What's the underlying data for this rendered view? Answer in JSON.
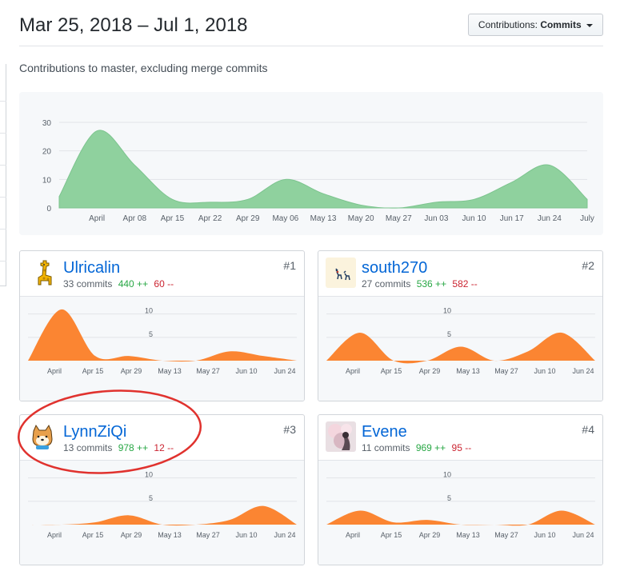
{
  "header": {
    "date_range": "Mar 25, 2018 – Jul 1, 2018",
    "contrib_label": "Contributions:",
    "contrib_value": "Commits"
  },
  "subtitle": "Contributions to master, excluding merge commits",
  "colors": {
    "main_area": "#8fd19e",
    "main_area_stroke": "#7cc48e",
    "user_area": "#fb8532",
    "link": "#0366d6",
    "additions": "#28a745",
    "deletions": "#cb2431",
    "highlight": "#e0322e"
  },
  "main_chart": {
    "y_ticks": [
      "30",
      "20",
      "10",
      "0"
    ],
    "x_ticks": [
      "April",
      "Apr 08",
      "Apr 15",
      "Apr 22",
      "Apr 29",
      "May 06",
      "May 13",
      "May 20",
      "May 27",
      "Jun 03",
      "Jun 10",
      "Jun 17",
      "Jun 24",
      "July"
    ]
  },
  "chart_data": [
    {
      "type": "area",
      "title": "",
      "x": [
        "Mar 25",
        "April",
        "Apr 08",
        "Apr 15",
        "Apr 22",
        "Apr 29",
        "May 06",
        "May 13",
        "May 20",
        "May 27",
        "Jun 03",
        "Jun 10",
        "Jun 17",
        "Jun 24",
        "July"
      ],
      "values": [
        4,
        27,
        15,
        3,
        2,
        3,
        10,
        5,
        1,
        0,
        2,
        3,
        9,
        15,
        3
      ],
      "ylim": [
        0,
        30
      ],
      "y_ticks": [
        0,
        10,
        20,
        30
      ],
      "grid": true
    },
    {
      "type": "area",
      "series_label": "Ulricalin",
      "x": [
        "Apr 1",
        "Apr 15",
        "Apr 29",
        "May 13",
        "May 27",
        "Jun 10",
        "Jun 24"
      ],
      "values": [
        11,
        1,
        1,
        0,
        0,
        2,
        1
      ],
      "ylim": [
        0,
        12
      ],
      "y_ticks": [
        5,
        10
      ]
    },
    {
      "type": "area",
      "series_label": "south270",
      "x": [
        "Apr 1",
        "Apr 15",
        "Apr 29",
        "May 13",
        "May 27",
        "Jun 10",
        "Jun 24"
      ],
      "values": [
        6,
        0,
        0,
        3,
        0,
        2,
        6
      ],
      "ylim": [
        0,
        12
      ],
      "y_ticks": [
        5,
        10
      ]
    },
    {
      "type": "area",
      "series_label": "LynnZiQi",
      "x": [
        "Apr 1",
        "Apr 15",
        "Apr 29",
        "May 13",
        "May 27",
        "Jun 10",
        "Jun 24"
      ],
      "values": [
        0,
        0.5,
        2,
        0,
        0,
        1,
        4
      ],
      "ylim": [
        0,
        12
      ],
      "y_ticks": [
        5,
        10
      ]
    },
    {
      "type": "area",
      "series_label": "Evene",
      "x": [
        "Apr 1",
        "Apr 15",
        "Apr 29",
        "May 13",
        "May 27",
        "Jun 10",
        "Jun 24"
      ],
      "values": [
        3,
        0.5,
        1,
        0,
        0,
        0,
        3
      ],
      "ylim": [
        0,
        12
      ],
      "y_ticks": [
        5,
        10
      ]
    }
  ],
  "user_chart": {
    "y_ticks": [
      "10",
      "5"
    ],
    "x_ticks": [
      "April",
      "Apr 15",
      "Apr 29",
      "May 13",
      "May 27",
      "Jun 10",
      "Jun 24"
    ]
  },
  "contributors": [
    {
      "name": "Ulricalin",
      "commits": "33 commits",
      "additions": "440 ++",
      "deletions": "60 --",
      "rank": "#1",
      "avatar": "giraffe-avatar"
    },
    {
      "name": "south270",
      "commits": "27 commits",
      "additions": "536 ++",
      "deletions": "582 --",
      "rank": "#2",
      "avatar": "deer-avatar"
    },
    {
      "name": "LynnZiQi",
      "commits": "13 commits",
      "additions": "978 ++",
      "deletions": "12 --",
      "rank": "#3",
      "avatar": "shiba-avatar"
    },
    {
      "name": "Evene",
      "commits": "11 commits",
      "additions": "969 ++",
      "deletions": "95 --",
      "rank": "#4",
      "avatar": "blossom-avatar"
    }
  ]
}
